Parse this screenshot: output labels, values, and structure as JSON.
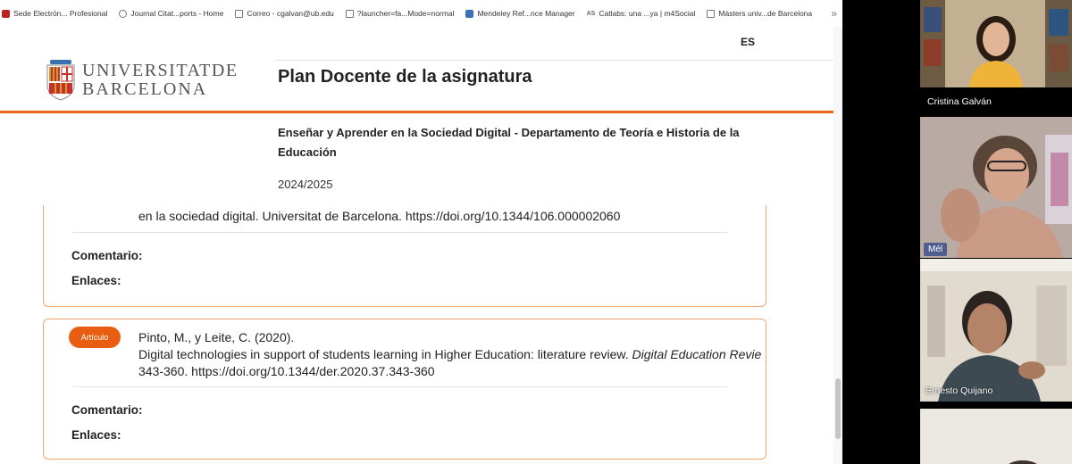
{
  "bookmarks": [
    {
      "label": "Sede Electrón... Profesional",
      "icon": "red"
    },
    {
      "label": "Journal Citat...ports - Home",
      "icon": "globe"
    },
    {
      "label": "Correo - cgalvan@ub.edu",
      "icon": "doc"
    },
    {
      "label": "?launcher=fa...Mode=normal",
      "icon": "doc"
    },
    {
      "label": "Mendeley Ref...nce Manager",
      "icon": "blue"
    },
    {
      "label": "Catlabs: una ...ya | m4Social",
      "icon": "as"
    },
    {
      "label": "Màsters univ...de Barcelona",
      "icon": "doc"
    }
  ],
  "header": {
    "lang": "ES",
    "logo_line1": "UNIVERSITATDE",
    "logo_line2": "BARCELONA",
    "title": "Plan Docente de la asignatura",
    "subject": "Enseñar y Aprender en la Sociedad Digital - Departamento de Teoría e Historia de la Educación",
    "year": "2024/2025"
  },
  "card1": {
    "line_partial": "en la sociedad digital. Universitat de Barcelona. https://doi.org/10.1344/106.000002060",
    "comment_label": "Comentario:",
    "links_label": "Enlaces:"
  },
  "card2": {
    "badge": "Artículo",
    "authors": "Pinto, M., y Leite, C. (2020).",
    "title_text": "Digital technologies in support of students learning in Higher Education: literature review.",
    "journal": "Digital Education Revie",
    "pages": "343-360. https://doi.org/10.1344/der.2020.37.343-360",
    "comment_label": "Comentario:",
    "links_label": "Enlaces:"
  },
  "participants": [
    {
      "name": "Cristina Galván"
    },
    {
      "name": "Mél"
    },
    {
      "name": "Ernesto Quijano"
    }
  ],
  "colors": {
    "accent": "#e8651a",
    "badge": "#e85d10"
  }
}
